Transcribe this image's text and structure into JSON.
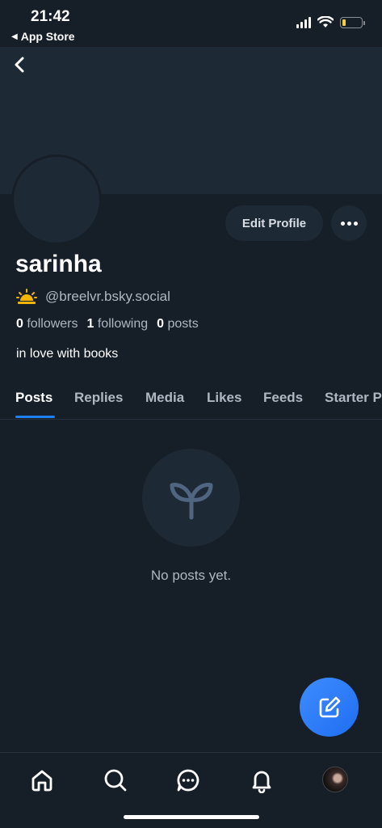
{
  "status_bar": {
    "time": "21:42",
    "back_label": "App Store",
    "back_arrow_glyph": "◀",
    "icons": [
      "cellular-signal-icon",
      "wifi-icon",
      "battery-icon"
    ],
    "battery_level": 0.2,
    "battery_color": "#f4d03f"
  },
  "header": {
    "back_icon": "chevron-left-icon"
  },
  "profile": {
    "display_name": "sarinha",
    "handle": "@breelvr.bsky.social",
    "handle_emoji_icon": "sunrise-icon",
    "followers_count": "0",
    "followers_label": "followers",
    "following_count": "1",
    "following_label": "following",
    "posts_count": "0",
    "posts_label": "posts",
    "bio": "in love with books",
    "edit_profile_label": "Edit Profile",
    "more_icon": "ellipsis-icon"
  },
  "tabs": [
    {
      "label": "Posts",
      "active": true
    },
    {
      "label": "Replies",
      "active": false
    },
    {
      "label": "Media",
      "active": false
    },
    {
      "label": "Likes",
      "active": false
    },
    {
      "label": "Feeds",
      "active": false
    },
    {
      "label": "Starter Packs",
      "active": false
    }
  ],
  "empty_state": {
    "icon": "seedling-icon",
    "message": "No posts yet."
  },
  "compose": {
    "icon": "compose-icon"
  },
  "bottom_nav": {
    "items": [
      "home-icon",
      "search-icon",
      "chat-icon",
      "bell-icon",
      "profile-avatar"
    ]
  },
  "colors": {
    "background": "#161e27",
    "surface": "#1e2936",
    "accent": "#1d82ef",
    "muted_text": "#aeb7c2",
    "icon_muted": "#4f6580"
  }
}
